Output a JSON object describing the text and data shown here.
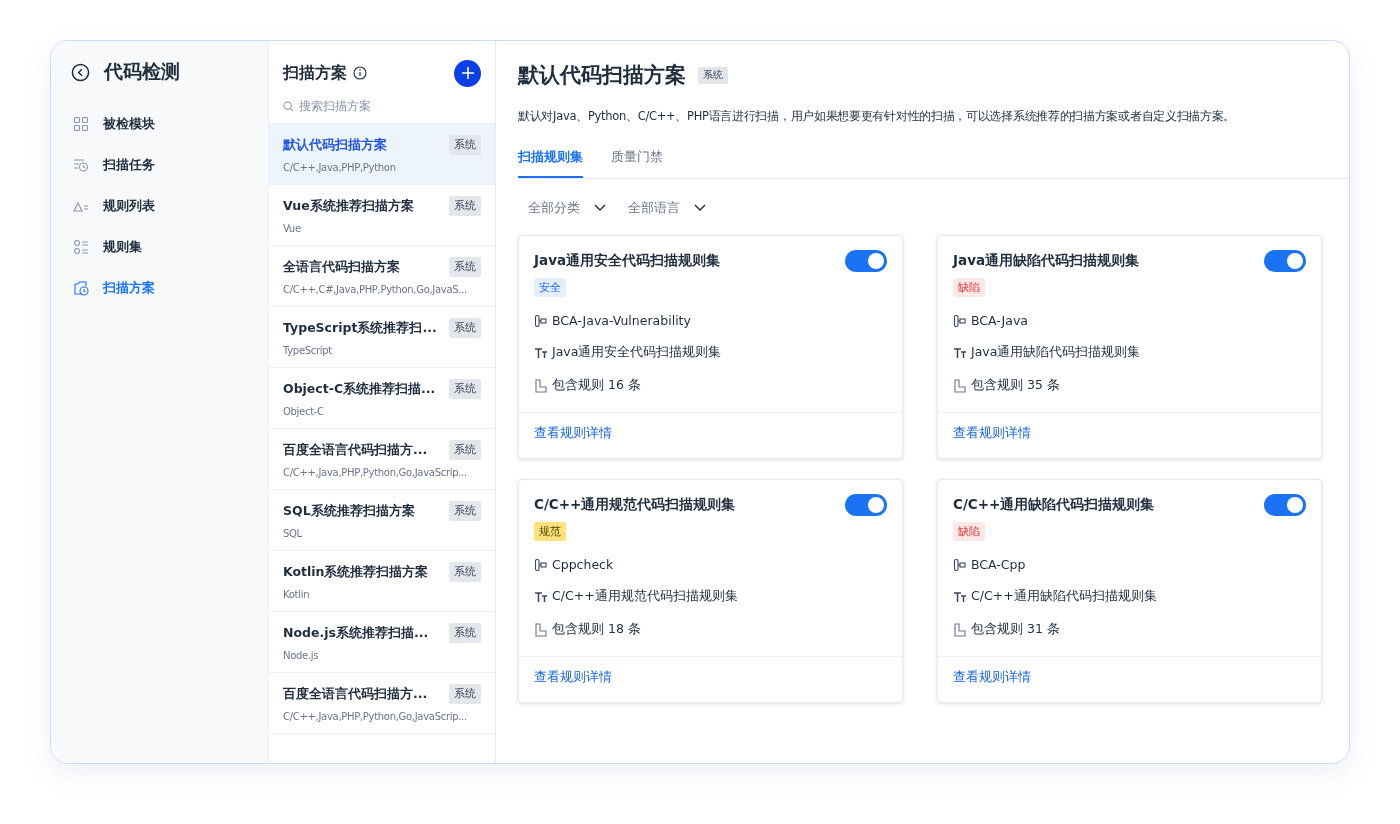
{
  "sidebar": {
    "title": "代码检测",
    "items": [
      {
        "label": "被检模块",
        "selected": false
      },
      {
        "label": "扫描任务",
        "selected": false
      },
      {
        "label": "规则列表",
        "selected": false
      },
      {
        "label": "规则集",
        "selected": false
      },
      {
        "label": "扫描方案",
        "selected": true
      }
    ]
  },
  "plans": {
    "title": "扫描方案",
    "search": {
      "placeholder": "搜索扫描方案"
    },
    "items": [
      {
        "name": "默认代码扫描方案",
        "badge": "系统",
        "languages": "C/C++,Java,PHP,Python",
        "selected": true
      },
      {
        "name": "Vue系统推荐扫描方案",
        "badge": "系统",
        "languages": "Vue",
        "selected": false
      },
      {
        "name": "全语言代码扫描方案",
        "badge": "系统",
        "languages": "C/C++,C#,Java,PHP,Python,Go,JavaS...",
        "selected": false
      },
      {
        "name": "TypeScript系统推荐扫...",
        "badge": "系统",
        "languages": "TypeScript",
        "selected": false
      },
      {
        "name": "Object-C系统推荐扫描...",
        "badge": "系统",
        "languages": "Object-C",
        "selected": false
      },
      {
        "name": "百度全语言代码扫描方...",
        "badge": "系统",
        "languages": "C/C++,Java,PHP,Python,Go,JavaScrip...",
        "selected": false
      },
      {
        "name": "SQL系统推荐扫描方案",
        "badge": "系统",
        "languages": "SQL",
        "selected": false
      },
      {
        "name": "Kotlin系统推荐扫描方案",
        "badge": "系统",
        "languages": "Kotlin",
        "selected": false
      },
      {
        "name": "Node.js系统推荐扫描...",
        "badge": "系统",
        "languages": "Node.js",
        "selected": false
      },
      {
        "name": "百度全语言代码扫描方...",
        "badge": "系统",
        "languages": "C/C++,Java,PHP,Python,Go,JavaScrip...",
        "selected": false
      }
    ]
  },
  "detail": {
    "title": "默认代码扫描方案",
    "badge": "系统",
    "description": "默认对Java、Python、C/C++、PHP语言进行扫描，用户如果想要更有针对性的扫描，可以选择系统推荐的扫描方案或者自定义扫描方案。",
    "tabs": [
      {
        "label": "扫描规则集",
        "selected": true
      },
      {
        "label": "质量门禁",
        "selected": false
      }
    ],
    "filters": [
      "全部分类",
      "全部语言"
    ],
    "rulesets": [
      {
        "title": "Java通用安全代码扫描规则集",
        "on": true,
        "tag": {
          "label": "安全",
          "kind": "security"
        },
        "tool": "BCA-Java-Vulnerability",
        "name": "Java通用安全代码扫描规则集",
        "count": "包含规则 16 条",
        "link": "查看规则详情"
      },
      {
        "title": "Java通用缺陷代码扫描规则集",
        "on": true,
        "tag": {
          "label": "缺陷",
          "kind": "defect"
        },
        "tool": "BCA-Java",
        "name": "Java通用缺陷代码扫描规则集",
        "count": "包含规则 35 条",
        "link": "查看规则详情"
      },
      {
        "title": "C/C++通用规范代码扫描规则集",
        "on": true,
        "tag": {
          "label": "规范",
          "kind": "standard"
        },
        "tool": "Cppcheck",
        "name": "C/C++通用规范代码扫描规则集",
        "count": "包含规则 18 条",
        "link": "查看规则详情"
      },
      {
        "title": "C/C++通用缺陷代码扫描规则集",
        "on": true,
        "tag": {
          "label": "缺陷",
          "kind": "defect"
        },
        "tool": "BCA-Cpp",
        "name": "C/C++通用缺陷代码扫描规则集",
        "count": "包含规则 31 条",
        "link": "查看规则详情"
      }
    ]
  }
}
